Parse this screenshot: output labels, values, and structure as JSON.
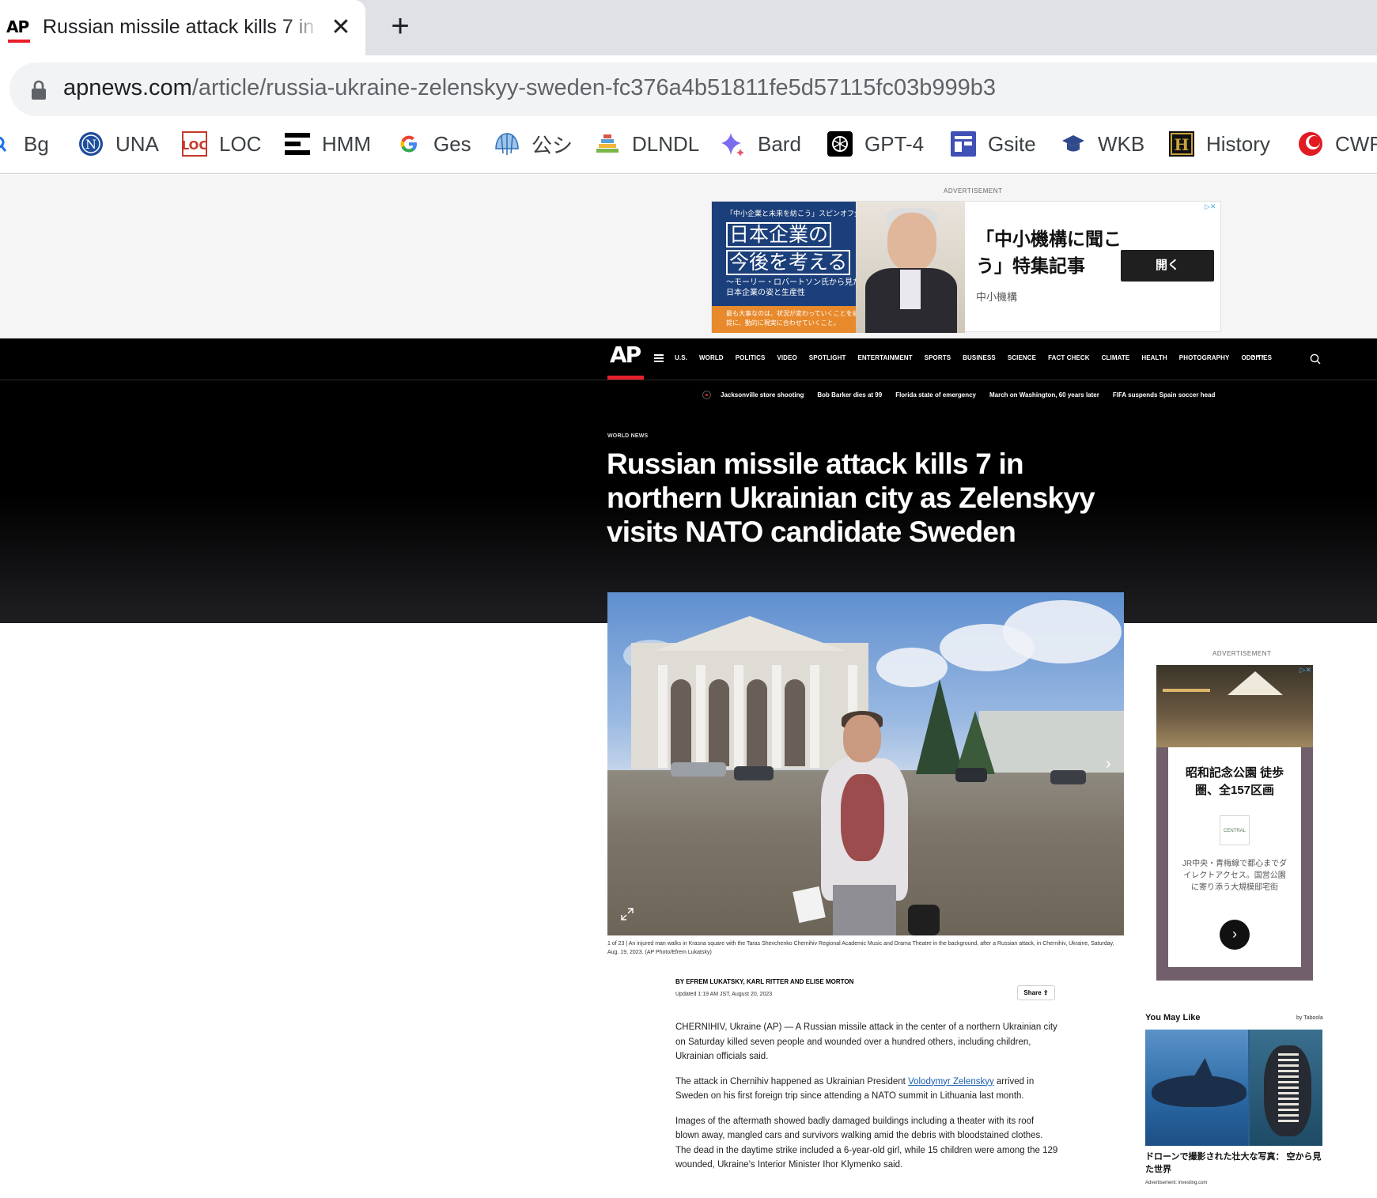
{
  "browser": {
    "tab_title": "Russian missile attack kills 7 in",
    "tab_favicon": "AP",
    "url_host": "apnews.com",
    "url_path": "/article/russia-ukraine-zelenskyy-sweden-fc376a4b51811fe5d57115fc03b999b3",
    "bookmarks": [
      {
        "label": "Bg",
        "icon": "search-icon"
      },
      {
        "label": "UNA",
        "icon": "n-badge-icon"
      },
      {
        "label": "LOC",
        "icon": "loc-icon"
      },
      {
        "label": "HMM",
        "icon": "hmm-icon"
      },
      {
        "label": "Ges",
        "icon": "google-icon"
      },
      {
        "label": "公シ",
        "icon": "shell-icon"
      },
      {
        "label": "DLNDL",
        "icon": "books-icon"
      },
      {
        "label": "Bard",
        "icon": "sparkle-icon"
      },
      {
        "label": "GPT-4",
        "icon": "openai-icon"
      },
      {
        "label": "Gsite",
        "icon": "sites-icon"
      },
      {
        "label": "WKB",
        "icon": "graduation-cap-icon"
      },
      {
        "label": "History",
        "icon": "history-channel-icon"
      },
      {
        "label": "CWR",
        "icon": "red-circle-icon"
      }
    ]
  },
  "top_ad": {
    "label": "ADVERTISEMENT",
    "small_text": "「中小企業と未来を紡こう」スピンオフ企画",
    "line1": "日本企業の",
    "line2": "今後を考える",
    "line3": "〜モーリー・ロバートソン氏から見た日本企業の姿と生産性",
    "orange_text": "最も大事なのは、状況が変わっていくことを前提に、動的に現実に合わせていくこと。",
    "headline": "「中小機構に聞こう」特集記事",
    "sponsor": "中小機構",
    "button": "開く"
  },
  "nav": {
    "items": [
      "U.S.",
      "WORLD",
      "POLITICS",
      "VIDEO",
      "SPOTLIGHT",
      "ENTERTAINMENT",
      "SPORTS",
      "BUSINESS",
      "SCIENCE",
      "FACT CHECK",
      "CLIMATE",
      "HEALTH",
      "PHOTOGRAPHY",
      "ODDITIES"
    ],
    "more": "···"
  },
  "trending": [
    "Jacksonville store shooting",
    "Bob Barker dies at 99",
    "Florida state of emergency",
    "March on Washington, 60 years later",
    "FIFA suspends Spain soccer head"
  ],
  "article": {
    "section": "WORLD NEWS",
    "headline": "Russian missile attack kills 7 in northern Ukrainian city as Zelenskyy visits NATO candidate Sweden",
    "caption": "1 of 23 | An injured man walks in Krasna square with the Taras Shevchenko Chernihiv Regional Academic Music and Drama Theatre in the background, after a Russian attack, in Chernihiv, Ukraine, Saturday, Aug. 19, 2023. (AP Photo/Efrem Lukatsky)",
    "byline": "BY EFREM LUKATSKY, KARL RITTER AND ELISE MORTON",
    "updated": "Updated 1:19 AM JST, August 20, 2023",
    "share": "Share",
    "p1": "CHERNIHIV, Ukraine (AP) — A Russian missile attack in the center of a northern Ukrainian city on Saturday killed seven people and wounded over a hundred others, including children, Ukrainian officials said.",
    "p2_before": "The attack in Chernihiv happened as Ukrainian President ",
    "p2_link": "Volodymyr Zelenskyy",
    "p2_after": " arrived in Sweden on his first foreign trip since attending a NATO summit in Lithuania last month.",
    "p3": "Images of the aftermath showed badly damaged buildings including a theater with its roof blown away, mangled cars and survivors walking amid the debris with bloodstained clothes. The dead in the daytime strike included a 6-year-old girl, while 15 children were among the 129 wounded, Ukraine's Interior Minister Ihor Klymenko said."
  },
  "rail": {
    "ad_label": "ADVERTISEMENT",
    "ad_title": "昭和記念公園 徒歩圏、全157区画",
    "ad_logo": "CENTRAL",
    "ad_desc": "JR中央・青梅線で都心までダイレクトアクセス。国営公園に寄り添う大規模邸宅街",
    "ymal_title": "You May Like",
    "ymal_by": "by Taboola",
    "ymal_caption": "ドローンで撮影された壮大な写真： 空から見た世界",
    "ymal_adline": "Advertisement: investing.com"
  },
  "colors": {
    "ap_red": "#e8202a",
    "nav_bg": "#000000",
    "link": "#1a5eb0"
  }
}
